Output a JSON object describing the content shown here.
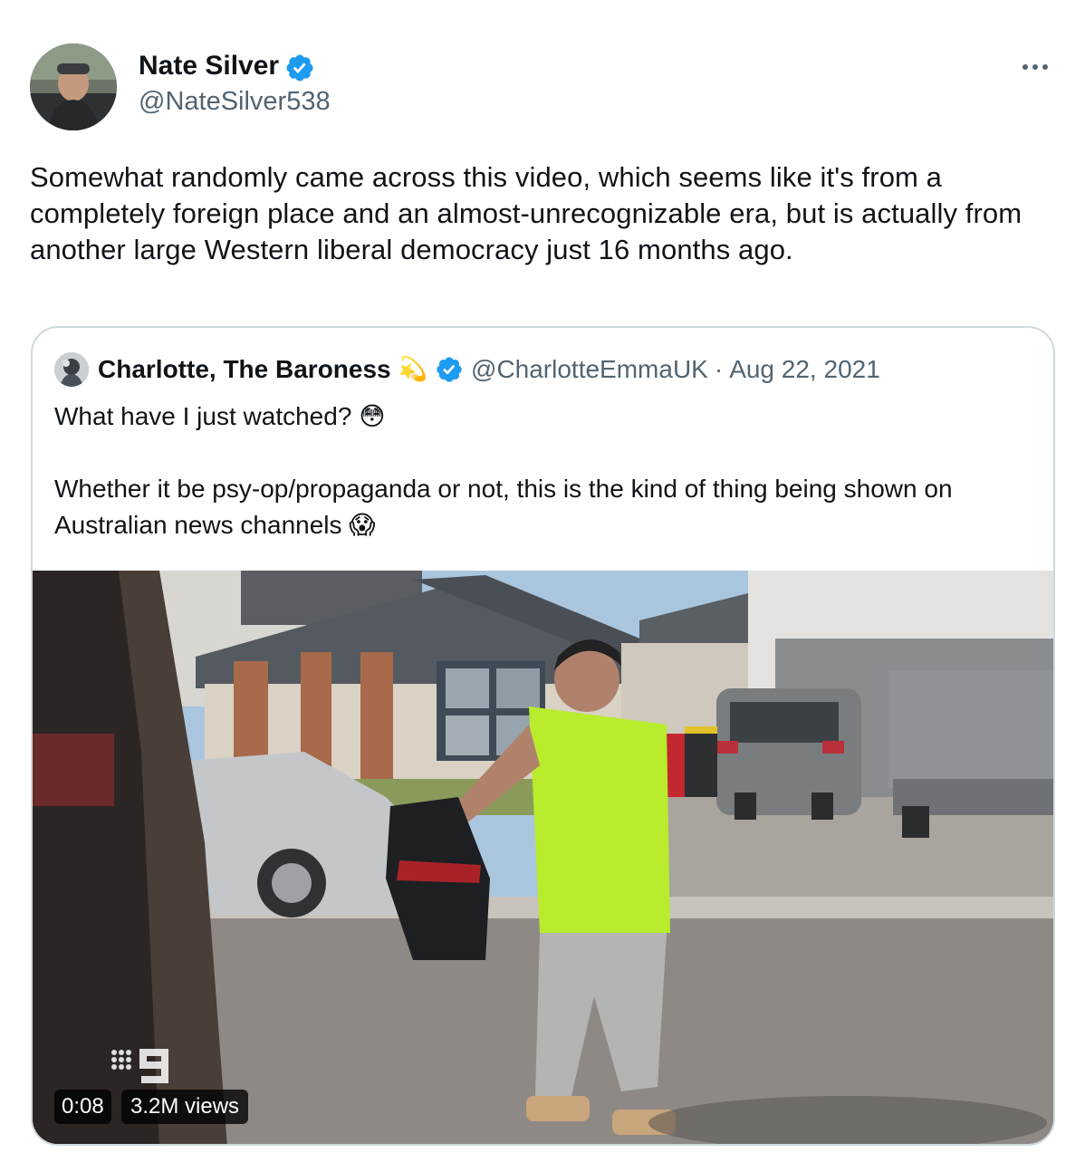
{
  "author": {
    "name": "Nate Silver",
    "handle": "@NateSilver538",
    "verified": true
  },
  "tweet": {
    "text": "Somewhat randomly came across this video, which seems like it's from a completely foreign place and an almost-unrecognizable era, but is actually from another large Western liberal democracy just 16 months ago."
  },
  "quote": {
    "name": "Charlotte, The Baroness",
    "name_emoji": "💫",
    "handle": "@CharlotteEmmaUK",
    "separator": "·",
    "date": "Aug 22, 2021",
    "line1": "What have I just watched?",
    "line1_emoji": "😳",
    "line2": "Whether it be psy-op/propaganda or not, this is the kind of thing being shown on Australian news channels",
    "line2_emoji": "😱"
  },
  "video": {
    "duration": "0:08",
    "views": "3.2M views"
  },
  "colors": {
    "verified": "#1d9bf0",
    "text_primary": "#0f1419",
    "text_secondary": "#536471",
    "border": "#cfd9de"
  },
  "icons": {
    "verified": "verified-badge-icon",
    "more": "more-options-icon"
  }
}
